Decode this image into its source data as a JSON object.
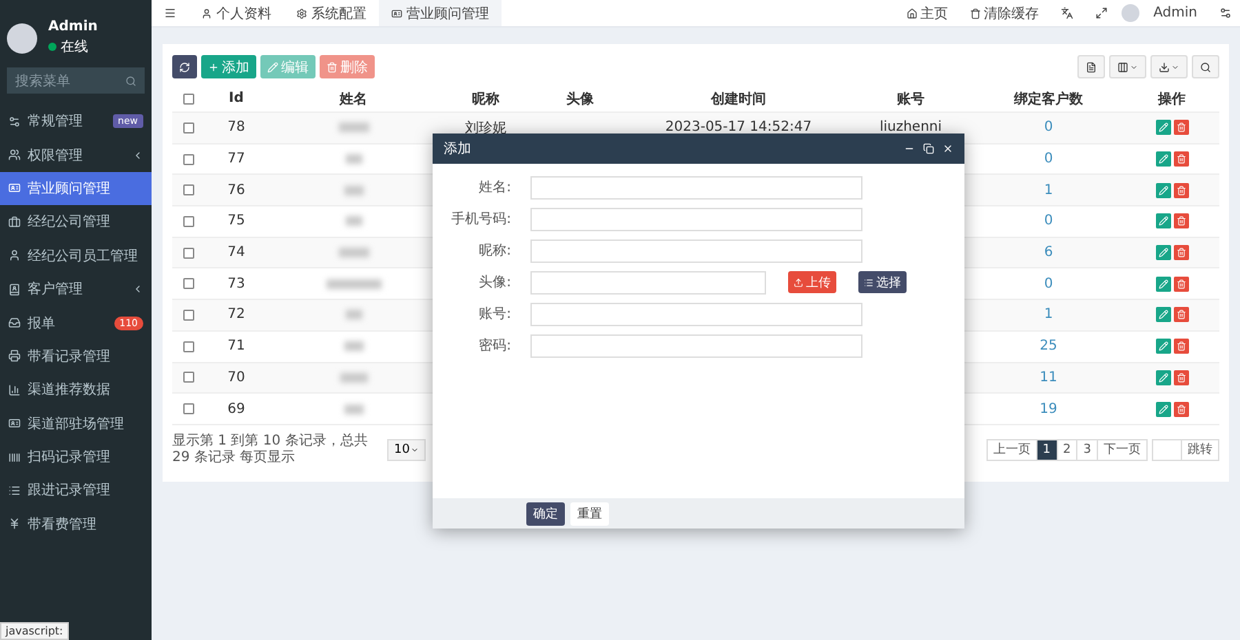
{
  "sidebar": {
    "user": {
      "name": "Admin",
      "status": "在线",
      "online": true
    },
    "search": {
      "placeholder": "搜索菜单"
    },
    "items": [
      {
        "label": "常规管理",
        "selected": false,
        "has_submenu": false,
        "badge": {
          "text": "new",
          "color": "#605ca8"
        }
      },
      {
        "label": "权限管理",
        "selected": false,
        "has_submenu": true
      },
      {
        "label": "营业顾问管理",
        "selected": true,
        "has_submenu": false
      },
      {
        "label": "经纪公司管理",
        "selected": false,
        "has_submenu": false
      },
      {
        "label": "经纪公司员工管理",
        "selected": false,
        "has_submenu": false
      },
      {
        "label": "客户管理",
        "selected": false,
        "has_submenu": true
      },
      {
        "label": "报单",
        "selected": false,
        "has_submenu": false,
        "badge": {
          "text": "110",
          "color": "#e74c3c"
        }
      },
      {
        "label": "带看记录管理",
        "selected": false,
        "has_submenu": false
      },
      {
        "label": "渠道推荐数据",
        "selected": false,
        "has_submenu": false
      },
      {
        "label": "渠道部驻场管理",
        "selected": false,
        "has_submenu": false
      },
      {
        "label": "扫码记录管理",
        "selected": false,
        "has_submenu": false
      },
      {
        "label": "跟进记录管理",
        "selected": false,
        "has_submenu": false
      },
      {
        "label": "带看费管理",
        "selected": false,
        "has_submenu": false
      }
    ]
  },
  "topbar": {
    "tabs": [
      {
        "label": "个人资料",
        "selected": false
      },
      {
        "label": "系统配置",
        "selected": false
      },
      {
        "label": "营业顾问管理",
        "selected": true
      }
    ],
    "links": [
      "主页",
      "清除缓存"
    ],
    "user": "Admin"
  },
  "toolbar": {
    "buttons": [
      {
        "kind": "refresh",
        "disabled": false
      },
      {
        "kind": "add",
        "label": "添加",
        "disabled": false
      },
      {
        "kind": "edit",
        "label": "编辑",
        "disabled": true
      },
      {
        "kind": "delete",
        "label": "删除",
        "disabled": true
      }
    ]
  },
  "table": {
    "header_checked": false,
    "columns": [
      "Id",
      "姓名",
      "昵称",
      "头像",
      "创建时间",
      "账号",
      "绑定客户数",
      "操作"
    ],
    "rows": [
      {
        "id": "78",
        "checked": false,
        "nickname": "刘珍妮",
        "created": "2023-05-17 14:52:47",
        "account": "liuzhenni",
        "count": "0"
      },
      {
        "id": "77",
        "checked": false,
        "count": "0"
      },
      {
        "id": "76",
        "checked": false,
        "count": "1"
      },
      {
        "id": "75",
        "checked": false,
        "count": "0"
      },
      {
        "id": "74",
        "checked": false,
        "count": "6"
      },
      {
        "id": "73",
        "checked": false,
        "count": "0"
      },
      {
        "id": "72",
        "checked": false,
        "count": "1"
      },
      {
        "id": "71",
        "checked": false,
        "count": "25"
      },
      {
        "id": "70",
        "checked": false,
        "count": "11"
      },
      {
        "id": "69",
        "checked": false,
        "count": "19"
      }
    ]
  },
  "pagination": {
    "info": "显示第 1 到第 10 条记录，总共 29 条记录 每页显示",
    "page_size": "10",
    "pages": [
      {
        "label": "上一页",
        "selected": false
      },
      {
        "label": "1",
        "selected": true
      },
      {
        "label": "2",
        "selected": false
      },
      {
        "label": "3",
        "selected": false
      },
      {
        "label": "下一页",
        "selected": false
      }
    ],
    "go": "跳转"
  },
  "dialog": {
    "title": "添加",
    "fields": [
      {
        "label": "姓名:",
        "kind": "text"
      },
      {
        "label": "手机号码:",
        "kind": "text"
      },
      {
        "label": "昵称:",
        "kind": "text"
      },
      {
        "label": "头像:",
        "kind": "image",
        "buttons": [
          "上传",
          "选择"
        ]
      },
      {
        "label": "账号:",
        "kind": "text"
      },
      {
        "label": "密码:",
        "kind": "text"
      }
    ],
    "buttons": [
      {
        "label": "确定",
        "kind": "primary"
      },
      {
        "label": "重置",
        "kind": "default"
      }
    ]
  },
  "status_tip": "javascript:"
}
